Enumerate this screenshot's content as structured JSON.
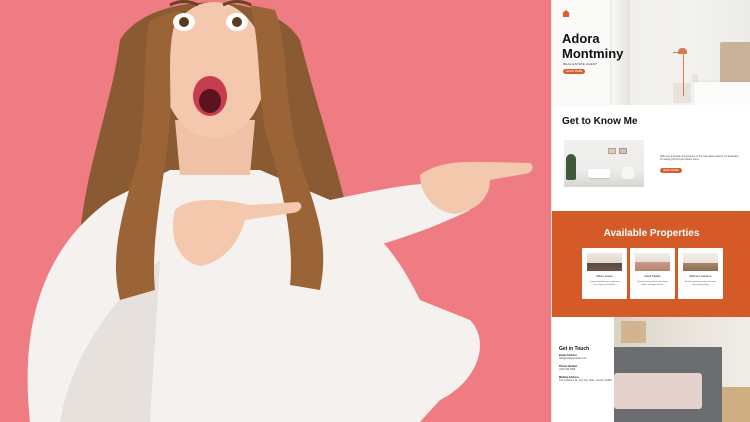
{
  "hero_photo": {
    "alt": ""
  },
  "preview": {
    "hero": {
      "name": "Adora Montminy",
      "role": "REAL ESTATE AGENT",
      "button": "LEARN MORE"
    },
    "know": {
      "title": "Get to Know Me",
      "text": "With over a decade of experience in the real estate industry, I'm dedicated to helping you find your dream home.",
      "button": "READ MORE"
    },
    "properties": {
      "title": "Available Properties",
      "cards": [
        {
          "name": "Abbey House",
          "desc": "Cozy one-bedroom in a quiet area near shops and schools."
        },
        {
          "name": "Swell Steads",
          "desc": "Spacious family home with a large garden and open kitchen."
        },
        {
          "name": "Elkhofer Gardens",
          "desc": "Modern townhouse with park views and private parking."
        }
      ]
    },
    "contact": {
      "title": "Get in Touch",
      "email_label": "Email Address",
      "email": "hello@reallygreatsite.com",
      "phone_label": "Phone Number",
      "phone": "(123) 456 7890",
      "mail_label": "Mailing Address",
      "mail": "123 Anywhere St., Any City, State, Country 12345"
    }
  },
  "colors": {
    "background_pink": "#ee7c82",
    "accent_orange": "#d45a27"
  }
}
